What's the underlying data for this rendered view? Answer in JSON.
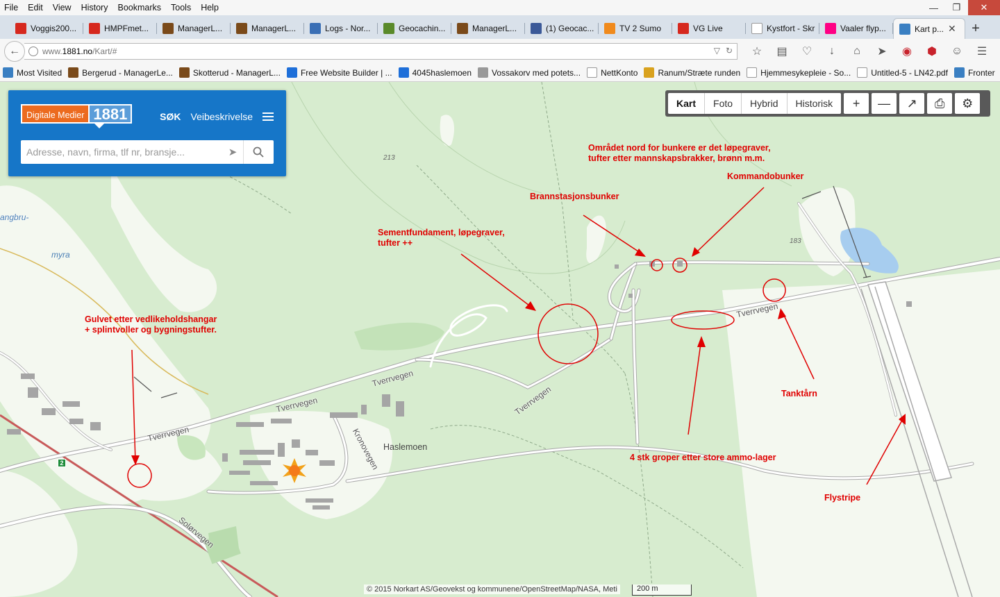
{
  "menu": [
    "File",
    "Edit",
    "View",
    "History",
    "Bookmarks",
    "Tools",
    "Help"
  ],
  "tabs": [
    {
      "label": "Voggis200...",
      "icon": "os-icon",
      "color": "#d6281e"
    },
    {
      "label": "HMPFmet...",
      "icon": "os-icon",
      "color": "#d6281e"
    },
    {
      "label": "ManagerL...",
      "icon": "managerl-icon",
      "color": "#7a4a1a"
    },
    {
      "label": "ManagerL...",
      "icon": "managerl-icon",
      "color": "#7a4a1a"
    },
    {
      "label": "Logs - Nor...",
      "icon": "arrow-icon",
      "color": "#3a6fb5"
    },
    {
      "label": "Geocachin...",
      "icon": "geocaching-icon",
      "color": "#5a8a2a"
    },
    {
      "label": "ManagerL...",
      "icon": "managerl-icon",
      "color": "#7a4a1a"
    },
    {
      "label": "(1) Geocac...",
      "icon": "facebook-icon",
      "color": "#3b5998"
    },
    {
      "label": "TV 2 Sumo",
      "icon": "tv2-icon",
      "color": "#f08a1c"
    },
    {
      "label": "VG Live",
      "icon": "vg-icon",
      "color": "#d6281e"
    },
    {
      "label": "Kystfort - Skriv...",
      "icon": "blank-icon",
      "color": "#ffffff"
    },
    {
      "label": "Vaaler flyp...",
      "icon": "flickr-icon",
      "color": "#ff0084"
    }
  ],
  "active_tab": {
    "label": "Kart p...",
    "icon": "map-icon",
    "color": "#3a7fc2"
  },
  "url": {
    "pre": "www.",
    "host": "1881.no",
    "path": "/Kart/#"
  },
  "bookmarks": [
    {
      "label": "Most Visited",
      "color": "#3a7fc2"
    },
    {
      "label": "Bergerud - ManagerLe...",
      "color": "#7a4a1a"
    },
    {
      "label": "Skotterud - ManagerL...",
      "color": "#7a4a1a"
    },
    {
      "label": "Free Website Builder | ...",
      "color": "#1e6fd9"
    },
    {
      "label": "4045haslemoen",
      "color": "#1e6fd9"
    },
    {
      "label": "Vossakorv med potets...",
      "color": "#999999"
    },
    {
      "label": "NettKonto",
      "color": "#ffffff"
    },
    {
      "label": "Ranum/Stræte runden",
      "color": "#d9a21e"
    },
    {
      "label": "Hjemmesykepleie - So...",
      "color": "#ffffff"
    },
    {
      "label": "Untitled-5 - LN42.pdf",
      "color": "#ffffff"
    },
    {
      "label": "Fronter",
      "color": "#3a7fc2"
    }
  ],
  "panel": {
    "logo_text": "Digitale Medier",
    "logo_number": "1881",
    "sok": "SØK",
    "veibeskrivelse": "Veibeskrivelse",
    "search_placeholder": "Adresse, navn, firma, tlf nr, bransje..."
  },
  "map_toolbar": {
    "kart": "Kart",
    "foto": "Foto",
    "hybrid": "Hybrid",
    "historisk": "Historisk",
    "active": "Kart"
  },
  "map_labels": {
    "elev_213": "213",
    "elev_183": "183",
    "angbru": "angbru-",
    "myra": "myra",
    "tverrvegen_1": "Tverrvegen",
    "tverrvegen_2": "Tverrvegen",
    "tverrvegen_3": "Tverrvegen",
    "tverrvegen_4": "Tverrvegen",
    "tverrvegen_5": "Tverrvegen",
    "haslemoen": "Haslemoen",
    "kronovegen": "Kronovegen",
    "solorvegen": "Solørvegen",
    "road_2": "2"
  },
  "annotations": {
    "omradet": [
      "Området nord for bunkere er det løpegraver,",
      "tufter etter mannskapsbrakker, brønn m.m."
    ],
    "kommandobunker": "Kommandobunker",
    "brannstasjon": "Brannstasjonsbunker",
    "sement": [
      "Sementfundament, løpegraver,",
      "tufter ++"
    ],
    "gulvet": [
      "Gulvet etter vedlikeholdshangar",
      "+ splintvoller og bygningstufter."
    ],
    "tanktarn": "Tanktårn",
    "ammo": "4 stk groper etter store ammo-lager",
    "flystripe": "Flystripe"
  },
  "attribution": "© 2015 Norkart AS/Geovekst og kommunene/OpenStreetMap/NASA, Meti",
  "scale": "200 m",
  "colors": {
    "annotation": "#e00000",
    "panel": "#1676c8",
    "logo_orange": "#ec6b1f",
    "forest": "#d7eccf",
    "open_land": "#f4f8f0",
    "road": "#ffffff",
    "water": "#a7cdef",
    "rail": "#c85a5a"
  }
}
